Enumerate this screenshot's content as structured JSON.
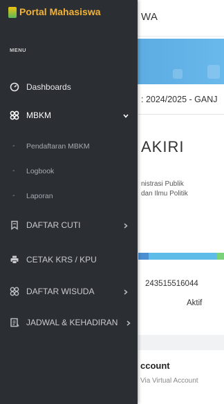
{
  "topbar": {
    "title": "WA"
  },
  "main": {
    "period": ": 2024/2025 - GANJ",
    "name": "AKIRI",
    "prodi_line1": "nistrasi Publik",
    "prodi_line2": "dan Ilmu Politik",
    "nim": "243515516044",
    "status": "Aktif",
    "account_title": "ccount",
    "account_sub": "Via Virtual Account"
  },
  "sidebar": {
    "brand": "Portal Mahasiswa",
    "menu_label": "MENU",
    "items": [
      {
        "label": "Dashboards",
        "icon": "gauge-icon"
      },
      {
        "label": "MBKM",
        "icon": "grid-icon",
        "expanded": true
      },
      {
        "label": "Pendaftaran MBKM",
        "sub": true
      },
      {
        "label": "Logbook",
        "sub": true
      },
      {
        "label": "Laporan",
        "sub": true
      },
      {
        "label": "DAFTAR CUTI",
        "icon": "bookmark-icon"
      },
      {
        "label": "CETAK KRS / KPU",
        "icon": "printer-icon"
      },
      {
        "label": "DAFTAR WISUDA",
        "icon": "grid-icon"
      },
      {
        "label": "JADWAL & KEHADIRAN",
        "icon": "list-icon"
      }
    ],
    "colors": {
      "bg": "#2b2e33",
      "brand": "#f3b234",
      "text": "#e6e7e9",
      "subtext": "#a7aab0"
    }
  }
}
